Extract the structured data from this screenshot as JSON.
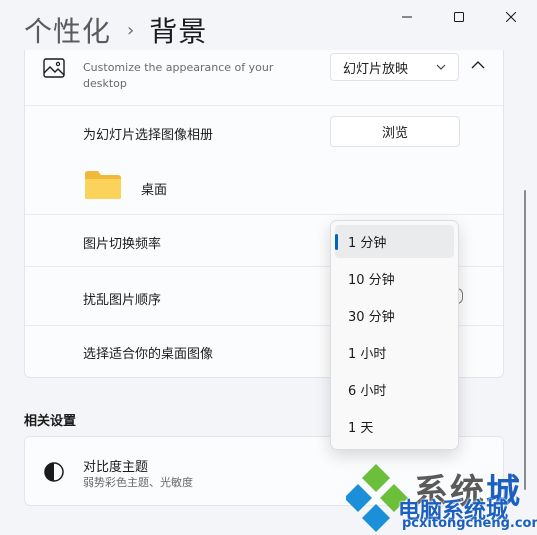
{
  "header": {
    "parent": "个性化",
    "separator": "›",
    "current": "背景"
  },
  "background_row": {
    "description": "Customize the appearance of your desktop",
    "selected_type": "幻灯片放映"
  },
  "album_row": {
    "label": "为幻灯片选择图像相册",
    "browse_label": "浏览",
    "folder_name": "桌面"
  },
  "frequency_row": {
    "label": "图片切换频率"
  },
  "shuffle_row": {
    "label": "扰乱图片顺序"
  },
  "fit_row": {
    "label": "选择适合你的桌面图像"
  },
  "related": {
    "section_title": "相关设置",
    "contrast_title": "对比度主题",
    "contrast_desc": "弱势彩色主题、光敏度"
  },
  "dropdown": {
    "options": [
      "1 分钟",
      "10 分钟",
      "30 分钟",
      "1 小时",
      "6 小时",
      "1 天"
    ],
    "selected_index": 0
  },
  "watermark": {
    "brand_blue": "系",
    "brand_grey": "统",
    "brand_tail": "城",
    "subtitle": "电脑系统城",
    "url": "pcxitongcheng.com"
  },
  "colors": {
    "accent": "#0067c0",
    "folder": "#f7c948",
    "watermark_blue": "#1b5fc0"
  },
  "icons": {
    "minimize": "minimize-icon",
    "maximize": "maximize-icon",
    "close": "close-icon",
    "background": "image-icon",
    "chevron_down": "chevron-down-icon",
    "chevron_up": "chevron-up-icon",
    "folder": "folder-icon",
    "contrast": "contrast-icon"
  }
}
